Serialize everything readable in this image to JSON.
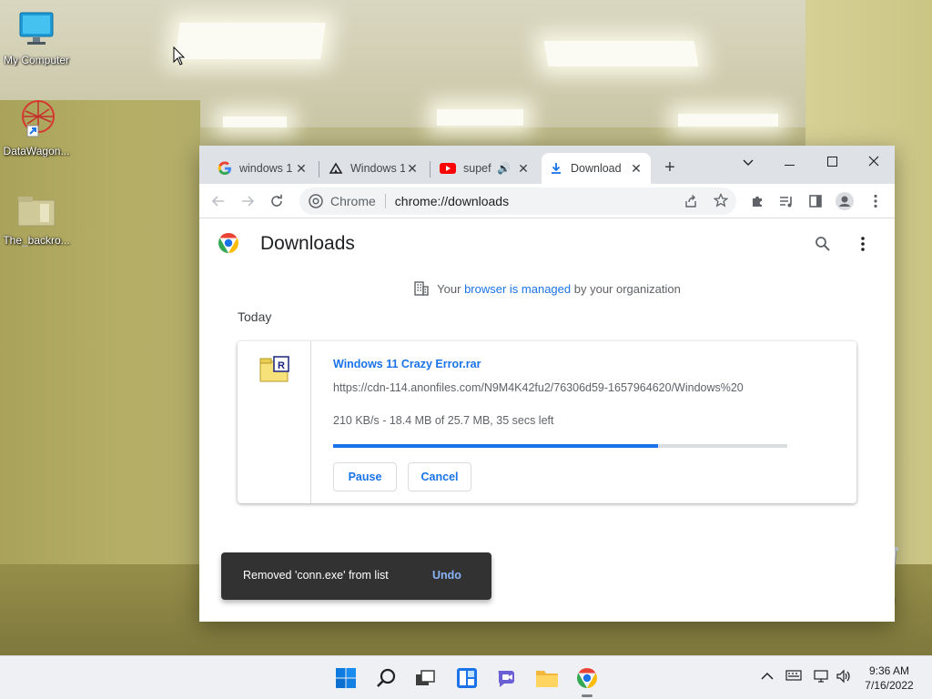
{
  "desktop": {
    "icons": [
      {
        "label": "My Computer"
      },
      {
        "label": "DataWagon..."
      },
      {
        "label": "The_backro..."
      }
    ],
    "recycle_label": "e Bin"
  },
  "browser": {
    "tabs": [
      {
        "title": "windows 1",
        "icon": "google-icon"
      },
      {
        "title": "Windows 1",
        "icon": "site-icon"
      },
      {
        "title": "supef",
        "icon": "youtube-icon",
        "audio": true
      },
      {
        "title": "Download",
        "icon": "download-icon",
        "active": true
      }
    ],
    "omnibox": {
      "chip": "Chrome",
      "url": "chrome://downloads"
    }
  },
  "downloads": {
    "title": "Downloads",
    "managed_prefix": "Your",
    "managed_link": "browser is managed",
    "managed_suffix": "by your organization",
    "section": "Today",
    "item": {
      "filename": "Windows 11 Crazy Error.rar",
      "url": "https://cdn-114.anonfiles.com/N9M4K42fu2/76306d59-1657964620/Windows%20",
      "status": "210 KB/s - 18.4 MB of 25.7 MB, 35 secs left",
      "progress_percent": 71.6,
      "pause_label": "Pause",
      "cancel_label": "Cancel"
    },
    "toast": {
      "message": "Removed 'conn.exe' from list",
      "undo": "Undo"
    }
  },
  "taskbar": {
    "time": "9:36 AM",
    "date": "7/16/2022"
  },
  "colors": {
    "accent": "#1a73e8",
    "toast_bg": "#323232",
    "undo": "#8ab4f8"
  }
}
